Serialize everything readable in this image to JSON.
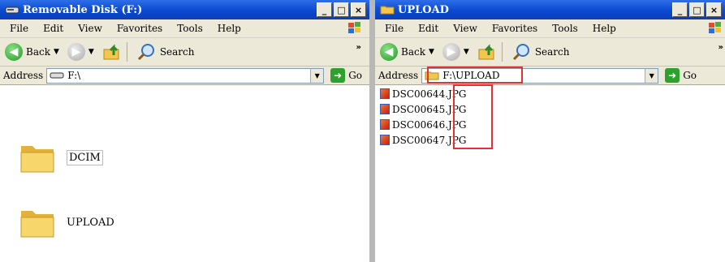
{
  "left_window": {
    "title": "Removable Disk (F:)",
    "controls": [
      "_",
      "□",
      "×"
    ],
    "menu": [
      "File",
      "Edit",
      "View",
      "Favorites",
      "Tools",
      "Help"
    ],
    "toolbar": {
      "back_label": "Back",
      "search_label": "Search",
      "more": "»"
    },
    "address": {
      "label": "Address",
      "value": "F:\\",
      "go_label": "Go"
    },
    "folders": [
      {
        "name": "DCIM"
      },
      {
        "name": "UPLOAD"
      }
    ]
  },
  "right_window": {
    "title": "UPLOAD",
    "controls": [
      "_",
      "□",
      "×"
    ],
    "menu": [
      "File",
      "Edit",
      "View",
      "Favorites",
      "Tools",
      "Help"
    ],
    "toolbar": {
      "back_label": "Back",
      "search_label": "Search",
      "more": "»"
    },
    "address": {
      "label": "Address",
      "value": "F:\\UPLOAD",
      "go_label": "Go"
    },
    "files": [
      {
        "base": "DSC00644",
        "ext": ".JPG"
      },
      {
        "base": "DSC00645",
        "ext": ".JPG"
      },
      {
        "base": "DSC00646",
        "ext": ".JPG"
      },
      {
        "base": "DSC00647",
        "ext": ".JPG"
      }
    ]
  },
  "highlight_color": "#e0332f",
  "icons": [
    "drive-icon",
    "folder-icon",
    "windows-flag-icon",
    "back-arrow-icon",
    "forward-arrow-icon",
    "up-folder-icon",
    "search-icon",
    "go-arrow-icon",
    "jpg-file-icon"
  ]
}
